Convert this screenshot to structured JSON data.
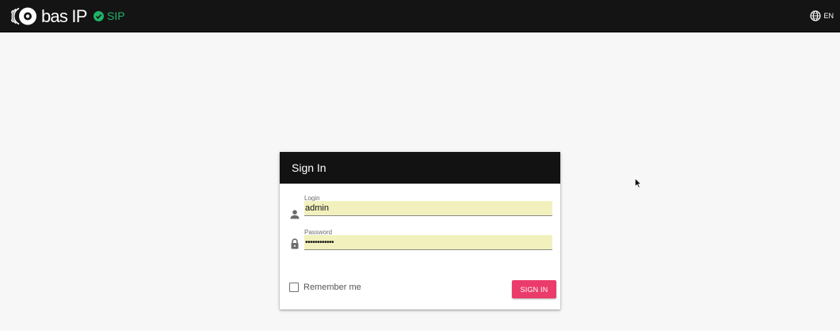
{
  "header": {
    "brand": "bas IP",
    "sip_status": "SIP",
    "language": "EN",
    "colors": {
      "background": "#141414",
      "sip_ok": "#1fb36a"
    }
  },
  "login_card": {
    "title": "Sign In",
    "login": {
      "label": "Login",
      "value": "admin",
      "icon": "person-icon"
    },
    "password": {
      "label": "Password",
      "value": "••••••••••••",
      "icon": "lock-icon"
    },
    "remember": {
      "label": "Remember me",
      "checked": false
    },
    "submit_label": "SIGN IN",
    "colors": {
      "header": "#121212",
      "autofill": "#f2f1be",
      "submit": "#ea3b6b"
    }
  }
}
